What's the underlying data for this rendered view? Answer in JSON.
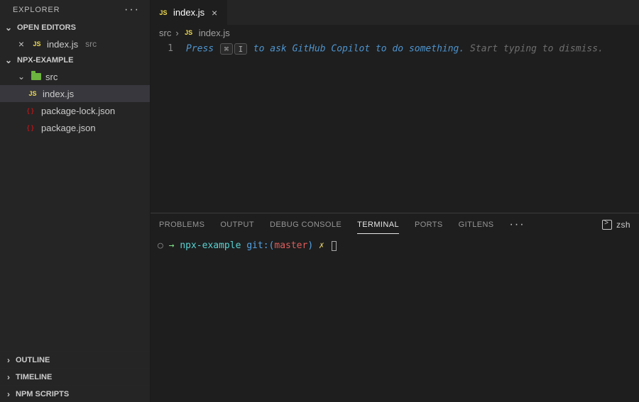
{
  "sidebar": {
    "title": "EXPLORER",
    "sections": {
      "open_editors": {
        "label": "OPEN EDITORS",
        "items": [
          {
            "icon": "JS",
            "name": "index.js",
            "dir": "src"
          }
        ]
      },
      "project": {
        "label": "NPX-EXAMPLE",
        "tree": {
          "src_label": "src",
          "files": [
            {
              "icon": "JS",
              "name": "index.js",
              "selected": true
            },
            {
              "icon": "json",
              "name": "package-lock.json"
            },
            {
              "icon": "json",
              "name": "package.json"
            }
          ]
        }
      },
      "collapsed": [
        "OUTLINE",
        "TIMELINE",
        "NPM SCRIPTS"
      ]
    }
  },
  "tab": {
    "icon": "JS",
    "name": "index.js"
  },
  "breadcrumb": {
    "parts": [
      "src",
      "index.js"
    ],
    "leaf_icon": "JS"
  },
  "editor": {
    "line_no": "1",
    "ghost": {
      "press": "Press",
      "key1": "⌘",
      "key2": "I",
      "ask": "to ask GitHub Copilot to do something.",
      "dismiss": "Start typing to dismiss."
    }
  },
  "panel": {
    "tabs": [
      "PROBLEMS",
      "OUTPUT",
      "DEBUG CONSOLE",
      "TERMINAL",
      "PORTS",
      "GITLENS"
    ],
    "active_tab": "TERMINAL",
    "shell": "zsh",
    "prompt": {
      "dir": "npx-example",
      "git_label": "git:(",
      "branch": "master",
      "git_close": ")",
      "dirty": "✗"
    }
  }
}
